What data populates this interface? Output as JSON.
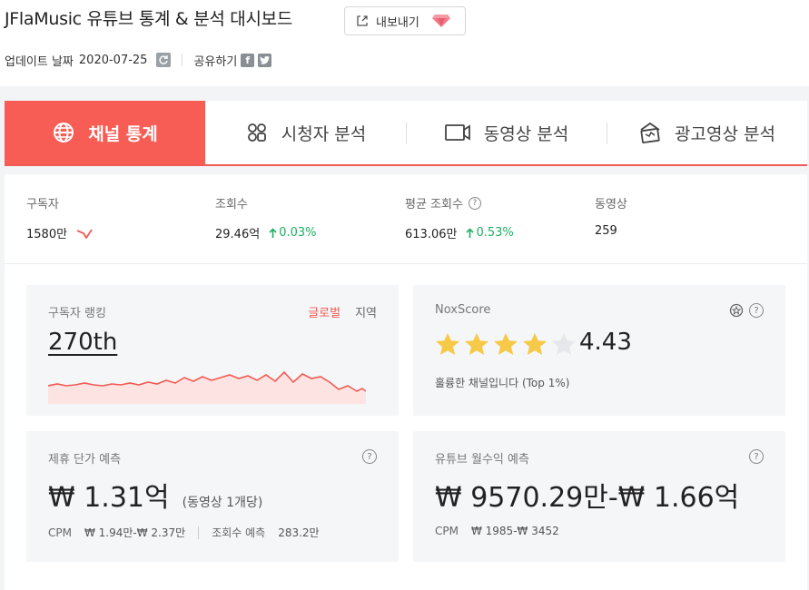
{
  "header": {
    "title": "JFlaMusic 유튜브 통계 & 분석 대시보드",
    "export_label": "내보내기",
    "updated_label": "업데이트 날짜",
    "updated_date": "2020-07-25",
    "share_label": "공유하기"
  },
  "tabs": [
    {
      "label": "채널 통계",
      "icon": "globe-icon",
      "active": true
    },
    {
      "label": "시청자 분석",
      "icon": "audience-icon",
      "active": false
    },
    {
      "label": "동영상 분석",
      "icon": "video-camera-icon",
      "active": false
    },
    {
      "label": "광고영상 분석",
      "icon": "ad-icon",
      "active": false
    }
  ],
  "stats": {
    "subscribers": {
      "label": "구독자",
      "value": "1580만"
    },
    "views": {
      "label": "조회수",
      "value": "29.46억",
      "change": "0.03%"
    },
    "avg_views": {
      "label": "평균 조회수",
      "value": "613.06만",
      "change": "0.53%"
    },
    "videos": {
      "label": "동영상",
      "value": "259"
    }
  },
  "ranking": {
    "label": "구독자 랭킹",
    "tab_global": "글로벌",
    "tab_region": "지역",
    "value": "270th"
  },
  "noxscore": {
    "label": "NoxScore",
    "score": "4.43",
    "stars_filled": 4,
    "stars_total": 5,
    "description": "훌륭한 채널입니다 (Top 1%)"
  },
  "partnership": {
    "label": "제휴 단가 예측",
    "value": "₩ 1.31억",
    "sub": "(동영상 1개당)",
    "cpm_label": "CPM",
    "cpm_value": "₩ 1.94만-₩ 2.37만",
    "views_label": "조회수 예측",
    "views_value": "283.2만"
  },
  "revenue": {
    "label": "유튜브 월수익 예측",
    "value": "₩ 9570.29만-₩ 1.66억",
    "cpm_label": "CPM",
    "cpm_value": "₩ 1985-₩ 3452"
  },
  "colors": {
    "accent": "#f75c55",
    "up": "#1fae63",
    "star": "#f7c948"
  }
}
